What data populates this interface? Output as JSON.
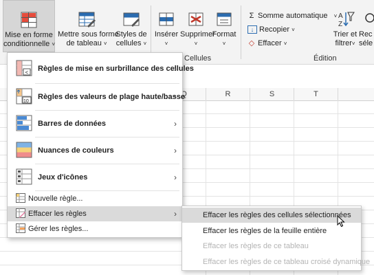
{
  "ribbon": {
    "conditional_formatting": {
      "line1": "Mise en forme",
      "line2": "conditionnelle",
      "chevron": "˅"
    },
    "format_as_table": {
      "line1": "Mettre sous forme",
      "line2": "de tableau",
      "chevron": "˅"
    },
    "cell_styles": {
      "line1": "Styles de",
      "line2": "cellules",
      "chevron": "˅"
    },
    "insert": {
      "label": "Insérer",
      "chevron": "˅"
    },
    "delete": {
      "label": "Supprimer",
      "chevron": "˅"
    },
    "format": {
      "label": "Format",
      "chevron": "˅"
    },
    "cells_group_label": "Cellules",
    "autosum": {
      "icon": "Σ",
      "label": "Somme automatique",
      "chevron": "˅"
    },
    "fill": {
      "icon": "↓",
      "label": "Recopier",
      "chevron": "˅"
    },
    "clear": {
      "icon": "◇",
      "label": "Effacer",
      "chevron": "˅"
    },
    "editing_group_label": "Édition",
    "sort_filter": {
      "line1": "Trier et",
      "line2": "filtrer",
      "chevron": "˅"
    },
    "find_partial": {
      "line1": "Rec",
      "line2": "séle"
    }
  },
  "columns": [
    "Q",
    "R",
    "S",
    "T"
  ],
  "menu": {
    "items": [
      {
        "label": "Règles de mise en surbrillance des cellules",
        "arrow": "›"
      },
      {
        "label": "Règles des valeurs de plage haute/basse",
        "arrow": "›"
      },
      {
        "label": "Barres de données",
        "arrow": "›"
      },
      {
        "label": "Nuances de couleurs",
        "arrow": "›"
      },
      {
        "label": "Jeux d'icônes",
        "arrow": "›"
      }
    ],
    "new_rule": "Nouvelle règle...",
    "clear_rules": {
      "label": "Effacer les règles",
      "arrow": "›"
    },
    "manage_rules": "Gérer les règles..."
  },
  "submenu": {
    "items": [
      {
        "label": "Effacer les règles  des cellules sélectionnées",
        "state": "highlighted"
      },
      {
        "label": "Effacer les règles de la feuille entière",
        "state": "enabled"
      },
      {
        "label": "Effacer les règles de ce tableau",
        "state": "disabled"
      },
      {
        "label": "Effacer les règles  de ce tableau croisé dynamique",
        "state": "disabled"
      }
    ]
  },
  "colors": {
    "highlight": "#dadada",
    "disabled_text": "#b4b4b4",
    "accent_blue": "#2b6cb0",
    "icon_red": "#c0392b"
  }
}
